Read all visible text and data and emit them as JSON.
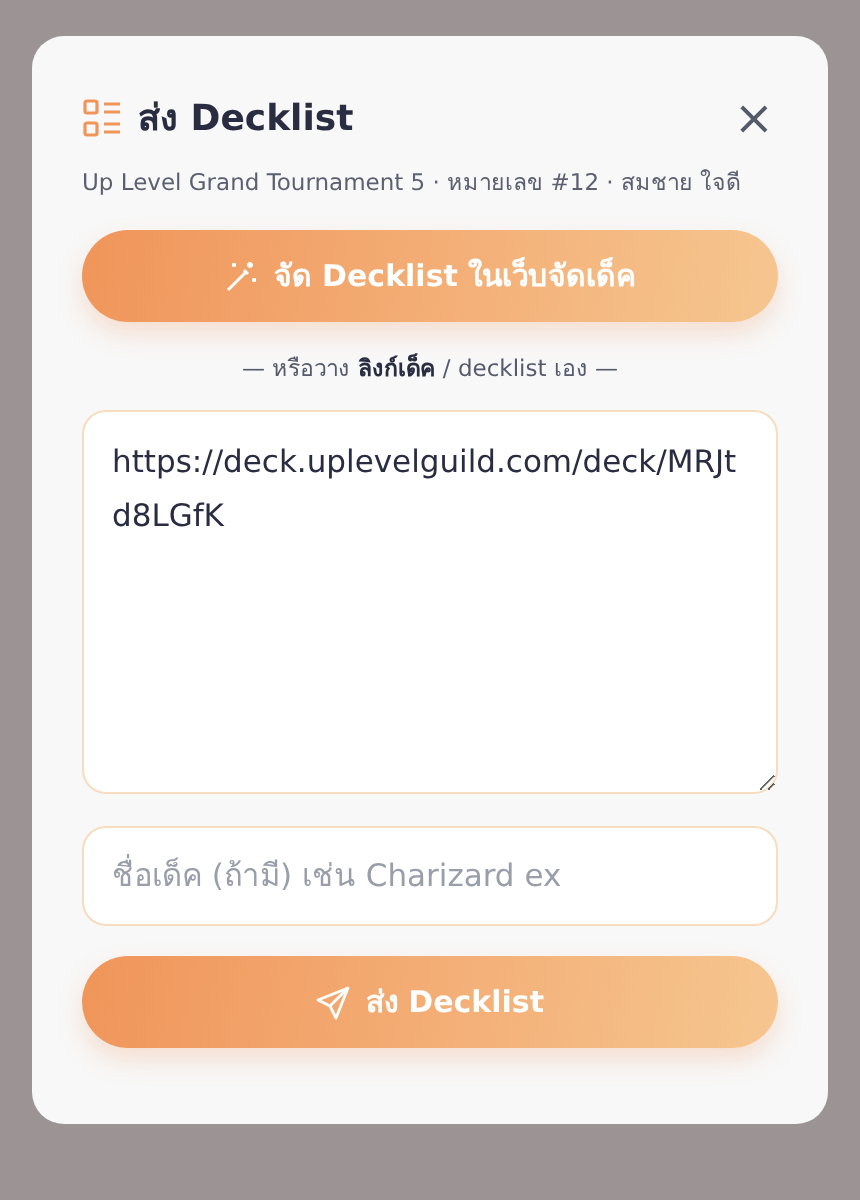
{
  "dialog": {
    "title": "ส่ง Decklist",
    "subtitle": "Up Level Grand Tournament 5 · หมายเลข #12 · สมชาย ใจดี",
    "close": "×"
  },
  "builder_button": {
    "label": "จัด Decklist ในเว็บจัดเด็ค"
  },
  "divider_text": "— หรือวาง **ลิงก์เด็ค** / decklist เอง —",
  "decklist_field": {
    "value": "https://deck.uplevelguild.com/deck/MRJtd8LGfK"
  },
  "deck_name_field": {
    "placeholder": "ชื่อเด็ค (ถ้ามี) เช่น Charizard ex"
  },
  "submit_button": {
    "label": "ส่ง Decklist"
  }
}
